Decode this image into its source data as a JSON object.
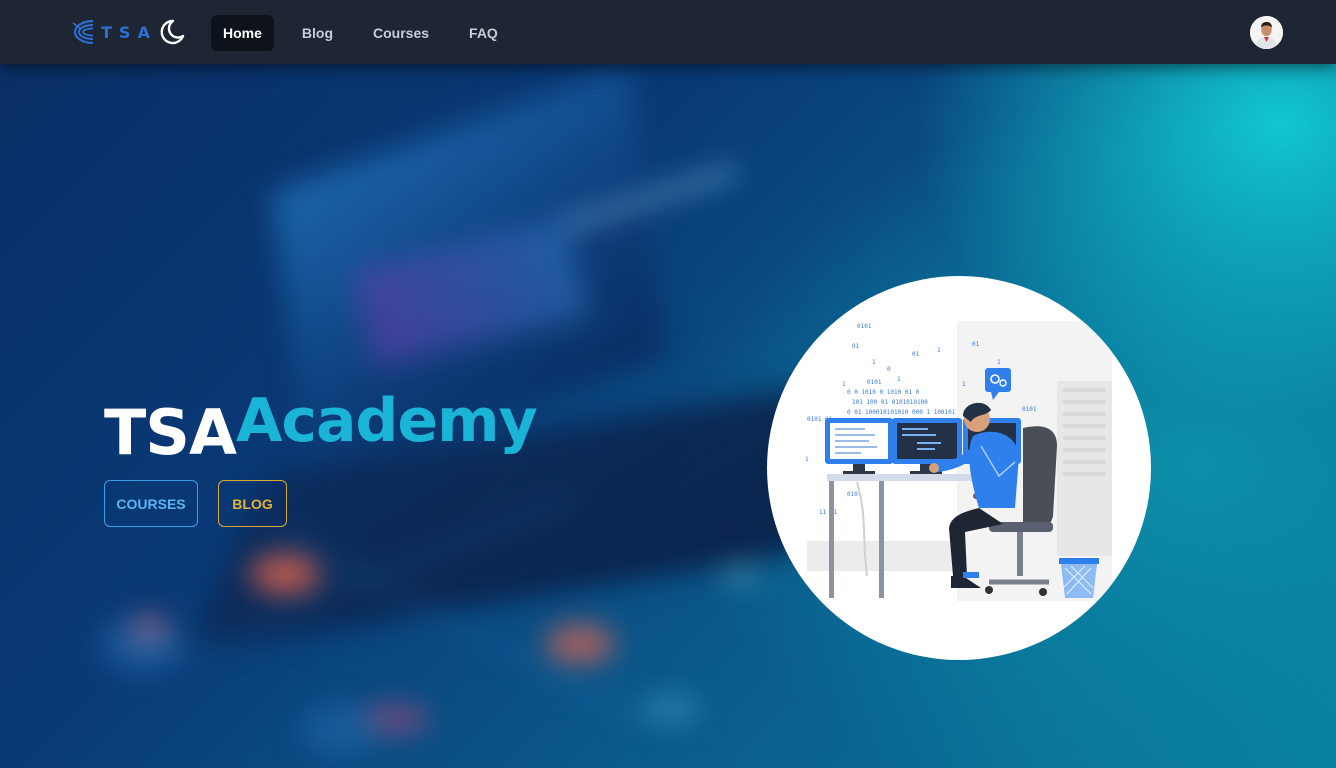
{
  "brand": {
    "logo_text": "TSA",
    "logo_color": "#2f6fd3"
  },
  "nav": {
    "theme_toggle_icon": "moon-icon",
    "links": [
      {
        "label": "Home",
        "active": true
      },
      {
        "label": "Blog",
        "active": false
      },
      {
        "label": "Courses",
        "active": false
      },
      {
        "label": "FAQ",
        "active": false
      }
    ],
    "avatar_icon": "user-avatar"
  },
  "hero": {
    "title_part1": "TSA",
    "title_part2": "Academy",
    "title_color_part1": "#ffffff",
    "title_color_part2": "#1ab4d6",
    "buttons": [
      {
        "label": "COURSES",
        "color": "#3b9be6"
      },
      {
        "label": "BLOG",
        "color": "#d8a734"
      }
    ],
    "illustration": "developer-at-workstation-illustration"
  },
  "colors": {
    "navbar_bg": "#1e2533",
    "active_nav_bg": "#0e121b"
  }
}
